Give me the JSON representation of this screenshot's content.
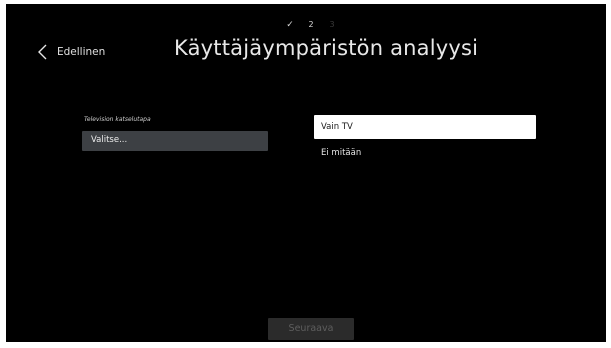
{
  "progress": {
    "steps": [
      "✓",
      "2",
      "3"
    ],
    "current_step": 2,
    "completed_steps": 1
  },
  "header": {
    "back_label": "Edellinen",
    "back_icon": "chevron-left-icon",
    "title": "Käyttäjäympäristön analyysi"
  },
  "form": {
    "field_label": "Television katselutapa",
    "select_value": "Valitse..."
  },
  "options": [
    {
      "label": "Vain TV",
      "selected": true
    },
    {
      "label": "Ei mitään",
      "selected": false
    }
  ],
  "footer": {
    "next_label": "Seuraava",
    "next_enabled": false
  },
  "colors": {
    "background": "#000000",
    "select_box": "#3d4044",
    "selected_option": "#ffffff",
    "disabled_button": "#2b2b2b"
  }
}
